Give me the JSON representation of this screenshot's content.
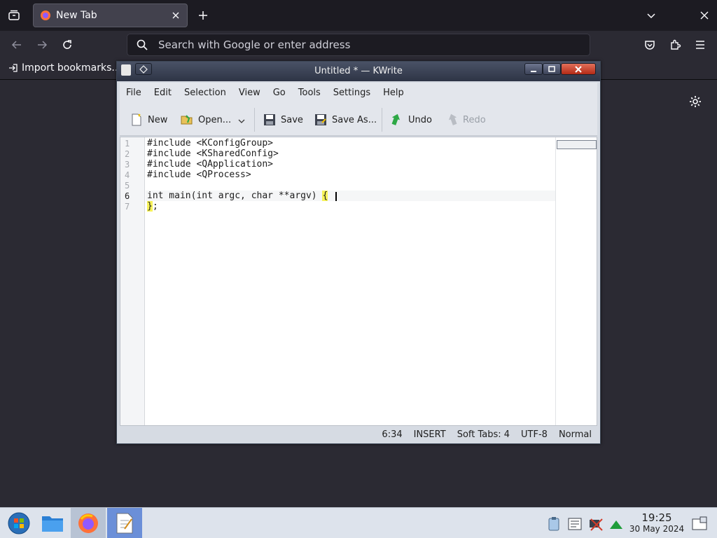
{
  "firefox": {
    "tab_title": "New Tab",
    "url_placeholder": "Search with Google or enter address",
    "bookmark_import": "Import bookmarks..."
  },
  "kwrite": {
    "window_title": "Untitled * — KWrite",
    "menu": [
      "File",
      "Edit",
      "Selection",
      "View",
      "Go",
      "Tools",
      "Settings",
      "Help"
    ],
    "toolbar": {
      "new": "New",
      "open": "Open...",
      "save": "Save",
      "save_as": "Save As...",
      "undo": "Undo",
      "redo": "Redo"
    },
    "line_numbers": [
      "1",
      "2",
      "3",
      "4",
      "5",
      "6",
      "7"
    ],
    "lines": [
      "#include <KConfigGroup>",
      "#include <KSharedConfig>",
      "#include <QApplication>",
      "#include <QProcess>",
      "",
      "int main(int argc, char **argv) ",
      ";"
    ],
    "open_brace": "{",
    "close_brace": "}",
    "status": {
      "position": "6:34",
      "mode": "INSERT",
      "indent": "Soft Tabs: 4",
      "encoding": "UTF-8",
      "input_mode": "Normal"
    }
  },
  "taskbar": {
    "time": "19:25",
    "date": "30 May 2024"
  },
  "colors": {
    "firefox_bg": "#2b2a33",
    "titlebar": "#2e3445",
    "bracket_highlight": "#f7f35a",
    "undo_green": "#2da845"
  }
}
